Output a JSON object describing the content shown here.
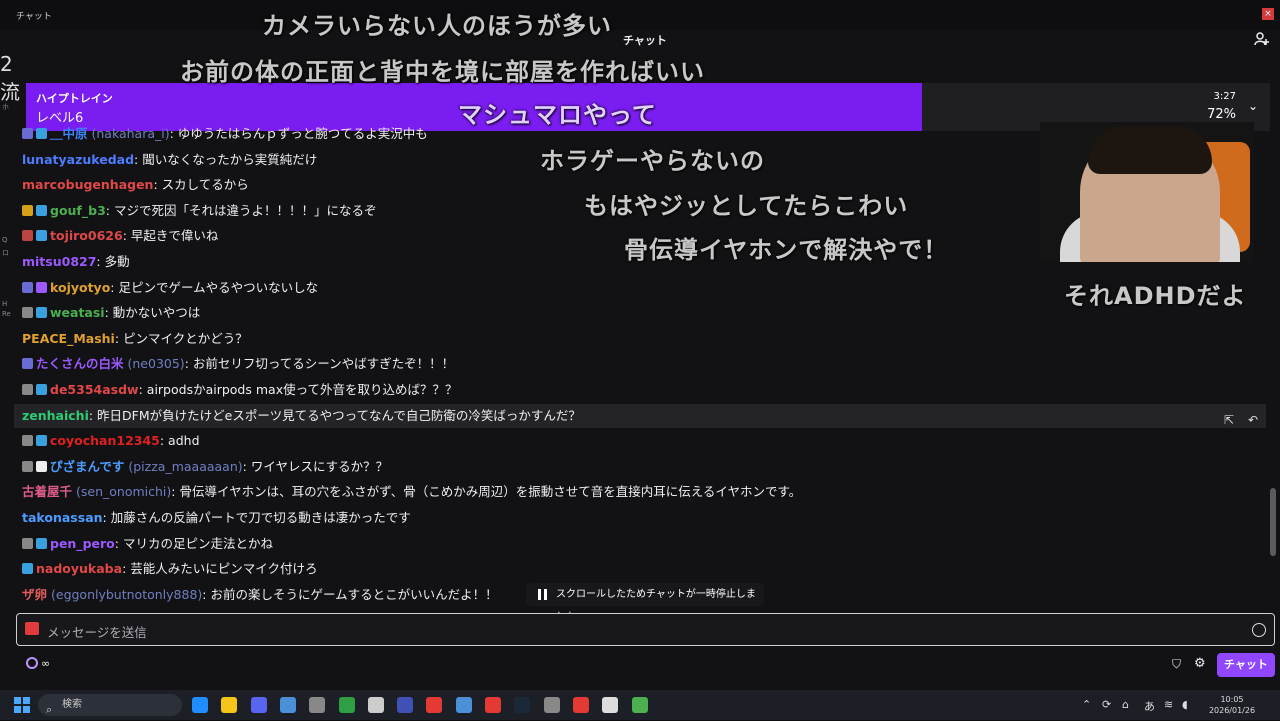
{
  "titlebar": {
    "app": "チャット",
    "close": "×"
  },
  "chat_header": "チャット",
  "left_edge": [
    "2流",
    "ホ",
    "Q",
    "ロ",
    "H",
    "Re"
  ],
  "hype_train": {
    "title": "ハイプトレイン",
    "level": "レベル6",
    "time": "3:27",
    "percent_label": "72%",
    "progress": 0.72,
    "chevron": "⌄"
  },
  "messages": [
    {
      "badges": [
        "#6b6bd6",
        "#3aa0e0"
      ],
      "name": "＿中原",
      "login": "(nakahara_i)",
      "color": "#3b82f6",
      "text": ": ゆゆうたはらんｐずっと腕つてるよ実況中も"
    },
    {
      "badges": [],
      "name": "lunatyazukedad",
      "login": "",
      "color": "#4d7cff",
      "text": ": 聞いなくなったから実質純だけ"
    },
    {
      "badges": [],
      "name": "marcobugenhagen",
      "login": "",
      "color": "#e04848",
      "text": ": スカしてるから"
    },
    {
      "badges": [
        "#d4a017",
        "#3aa0e0"
      ],
      "name": "gouf_b3",
      "login": "",
      "color": "#4caf50",
      "text": ": マジで死因「それは違うよ！！！！」になるぞ"
    },
    {
      "badges": [
        "#b44",
        "#3aa0e0"
      ],
      "name": "tojiro0626",
      "login": "",
      "color": "#e04848",
      "text": ": 早起きで偉いね"
    },
    {
      "badges": [],
      "name": "mitsu0827",
      "login": "",
      "color": "#9b59ff",
      "text": ": 多動"
    },
    {
      "badges": [
        "#6b6bd6",
        "#9b59ff"
      ],
      "name": "kojyotyo",
      "login": "",
      "color": "#e0a030",
      "text": ": 足ピンでゲームやるやついないしな"
    },
    {
      "badges": [
        "#888",
        "#3aa0e0"
      ],
      "name": "weatasi",
      "login": "",
      "color": "#4caf50",
      "text": ": 動かないやつは"
    },
    {
      "badges": [],
      "name": "PEACE_Mashi",
      "login": "",
      "color": "#e0a030",
      "text": ": ピンマイクとかどう？"
    },
    {
      "badges": [
        "#6b6bd6"
      ],
      "name": "たくさんの白米",
      "login": "(ne0305)",
      "color": "#9b59ff",
      "text": ": お前セリフ切ってるシーンやばすぎたぞ！！！"
    },
    {
      "badges": [
        "#888",
        "#3aa0e0"
      ],
      "name": "de5354asdw",
      "login": "",
      "color": "#e04848",
      "text": ": airpodsかairpods max使って外音を取り込めば？？？"
    },
    {
      "badges": [],
      "name": "zenhaichi",
      "login": "",
      "color": "#2ecc71",
      "text": ": 昨日DFMが負けたけどeスポーツ見てるやつってなんで自己防衛の冷笑ばっかすんだ？",
      "highlight": true
    },
    {
      "badges": [
        "#888",
        "#3aa0e0"
      ],
      "name": "coyochan12345",
      "login": "",
      "color": "#e02020",
      "text": ": adhd"
    },
    {
      "badges": [
        "#888",
        "#eee"
      ],
      "name": "ぴざまんです",
      "login": "(pizza_maaaaaan)",
      "color": "#4d9cff",
      "text": ": ワイヤレスにするか？？"
    },
    {
      "badges": [],
      "name": "古着屋千",
      "login": "(sen_onomichi)",
      "color": "#e05c8c",
      "text": ": 骨伝導イヤホンは、耳の穴をふさがず、骨（こめかみ周辺）を振動させて音を直接内耳に伝えるイヤホンです。"
    },
    {
      "badges": [],
      "name": "takonassan",
      "login": "",
      "color": "#4d9cff",
      "text": ": 加藤さんの反論パートで刀で切る動きは凄かったです"
    },
    {
      "badges": [
        "#888",
        "#3aa0e0"
      ],
      "name": "pen_pero",
      "login": "",
      "color": "#9b59ff",
      "text": ": マリカの足ピン走法とかね"
    },
    {
      "badges": [
        "#3aa0e0"
      ],
      "name": "nadoyukaba",
      "login": "",
      "color": "#e04848",
      "text": ": 芸能人みたいにピンマイク付けろ"
    },
    {
      "badges": [],
      "name": "ザ卵",
      "login": "(eggonlybutnotonly888)",
      "color": "#e05c5c",
      "text": ": お前の楽しそうにゲームするとこがいいんだよ！！"
    }
  ],
  "row_actions": [
    "⇱",
    "↶"
  ],
  "paused_notice": "スクロールしたためチャットが一時停止しました",
  "input": {
    "placeholder": "メッセージを送信"
  },
  "bottom": {
    "points": "∞",
    "send_label": "チャット"
  },
  "overlays": [
    "カメラいらない人のほうが多い",
    "お前の体の正面と背中を境に部屋を作ればいい",
    "マシュマロやって",
    "ホラゲーやらないの",
    "もはやジッとしてたらこわい",
    "骨伝導イヤホンで解決やで！",
    "それADHDだよ"
  ],
  "taskbar": {
    "search": "検索",
    "ime": "あ",
    "time": "10:05",
    "date": "2026/01/26",
    "icons": [
      "#1f8cff",
      "#f5c518",
      "#5865f2",
      "#4a90d9",
      "#888",
      "#2ea043",
      "#ccc",
      "#3f51b5",
      "#e53935",
      "#4a90d9",
      "#e53935",
      "#1b2838",
      "#888",
      "#e53935",
      "#ddd",
      "#4caf50"
    ]
  }
}
